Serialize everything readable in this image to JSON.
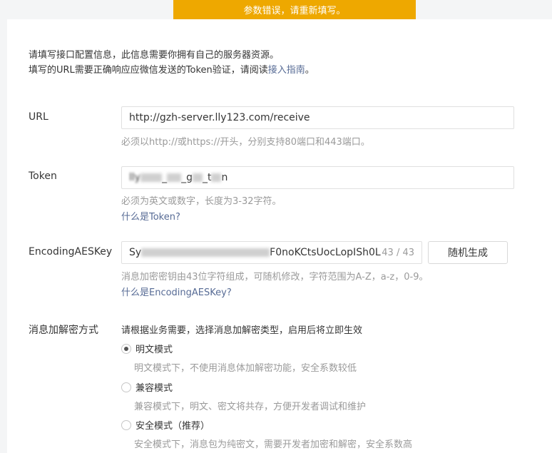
{
  "toast": {
    "text": "参数错误，请重新填写。"
  },
  "intro": {
    "line1": "请填写接口配置信息，此信息需要你拥有自己的服务器资源。",
    "line2_prefix": "填写的URL需要正确响应应微信发送的Token验证，请阅读",
    "line2_link": "接入指南",
    "line2_suffix": "。"
  },
  "url": {
    "label": "URL",
    "value": "http://gzh-server.lly123.com/receive",
    "hint": "必须以http://或https://开头，分别支持80端口和443端口。"
  },
  "token": {
    "label": "Token",
    "value_visible_prefix": "lly",
    "value_visible_mid1": "_",
    "value_visible_mid2": "_g",
    "value_visible_mid3": "_t",
    "value_visible_suffix": "n",
    "hint": "必须为英文或数字，长度为3-32字符。",
    "help_link": "什么是Token?"
  },
  "aes": {
    "label": "EncodingAESKey",
    "value_visible_prefix": "Sy",
    "value_visible_suffix": "F0noKCtsUocLopISh0L",
    "counter": "43 / 43",
    "generate_button": "随机生成",
    "hint": "消息加密密钥由43位字符组成，可随机修改，字符范围为A-Z，a-z，0-9。",
    "help_link": "什么是EncodingAESKey?"
  },
  "encryption": {
    "label": "消息加解密方式",
    "intro": "请根据业务需要，选择消息加解密类型，启用后将立即生效",
    "options": [
      {
        "label": "明文模式",
        "desc": "明文模式下，不使用消息体加解密功能，安全系数较低",
        "checked": true
      },
      {
        "label": "兼容模式",
        "desc": "兼容模式下，明文、密文将共存，方便开发者调试和维护",
        "checked": false
      },
      {
        "label": "安全模式（推荐）",
        "desc": "安全模式下，消息包为纯密文，需要开发者加密和解密，安全系数高",
        "checked": false
      }
    ]
  }
}
